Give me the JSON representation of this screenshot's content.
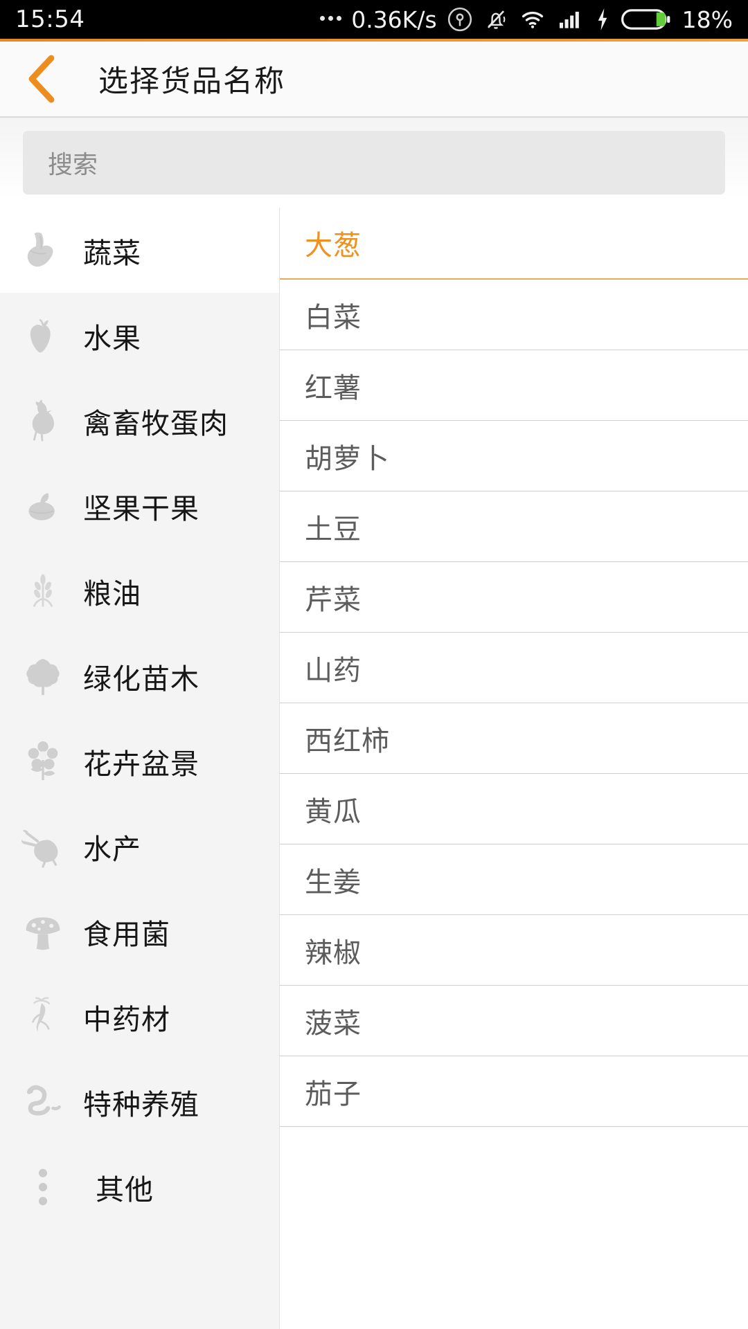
{
  "status_bar": {
    "time": "15:54",
    "network_speed": "0.36K/s",
    "battery_percent": "18%",
    "icons": [
      "more-dots-icon",
      "location-icon",
      "mute-bell-icon",
      "wifi-icon",
      "signal-bars-icon",
      "charging-bolt-icon",
      "battery-icon"
    ]
  },
  "header": {
    "back_icon": "chevron-left-icon",
    "title": "选择货品名称",
    "accent_color": "#ee8d1f"
  },
  "search": {
    "placeholder": "搜索",
    "value": ""
  },
  "categories": {
    "selected_index": 0,
    "items": [
      {
        "label": "蔬菜",
        "icon": "vegetable-icon"
      },
      {
        "label": "水果",
        "icon": "apple-icon"
      },
      {
        "label": "禽畜牧蛋肉",
        "icon": "rooster-icon"
      },
      {
        "label": "坚果干果",
        "icon": "nut-icon"
      },
      {
        "label": "粮油",
        "icon": "wheat-icon"
      },
      {
        "label": "绿化苗木",
        "icon": "tree-icon"
      },
      {
        "label": "花卉盆景",
        "icon": "flower-icon"
      },
      {
        "label": "水产",
        "icon": "shrimp-icon"
      },
      {
        "label": "食用菌",
        "icon": "mushroom-icon"
      },
      {
        "label": "中药材",
        "icon": "ginseng-icon"
      },
      {
        "label": "特种养殖",
        "icon": "snake-icon"
      },
      {
        "label": "其他",
        "icon": "more-vertical-icon"
      }
    ]
  },
  "goods": {
    "selected_index": 0,
    "selected_color": "#f0911e",
    "items": [
      {
        "label": "大葱"
      },
      {
        "label": "白菜"
      },
      {
        "label": "红薯"
      },
      {
        "label": "胡萝卜"
      },
      {
        "label": "土豆"
      },
      {
        "label": "芹菜"
      },
      {
        "label": "山药"
      },
      {
        "label": "西红柿"
      },
      {
        "label": "黄瓜"
      },
      {
        "label": "生姜"
      },
      {
        "label": "辣椒"
      },
      {
        "label": "菠菜"
      },
      {
        "label": "茄子"
      }
    ]
  }
}
